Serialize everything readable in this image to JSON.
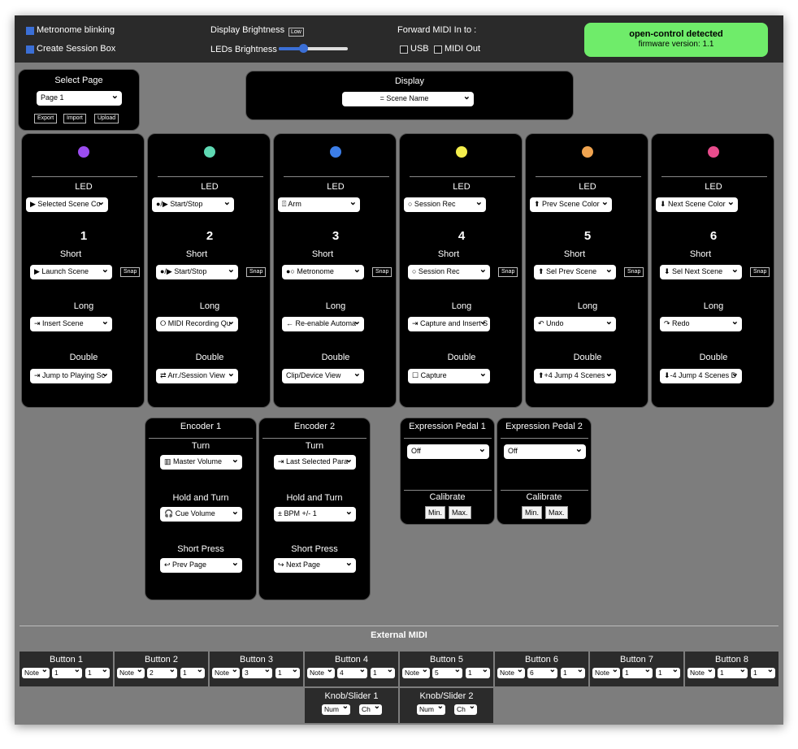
{
  "topbar": {
    "metronome_label": "Metronome blinking",
    "session_box_label": "Create Session Box",
    "display_brightness_label": "Display Brightness",
    "display_brightness_value": "Low",
    "leds_brightness_label": "LEDs Brightness",
    "leds_brightness_level": 0.35,
    "forward_label": "Forward MIDI In to :",
    "usb_label": "USB",
    "midi_out_label": "MIDI Out",
    "detect_title": "open-control detected",
    "firmware": "firmware version: 1.1"
  },
  "page_select": {
    "title": "Select Page",
    "value": "Page 1",
    "export": "Export",
    "import": "Import",
    "upload": "Upload"
  },
  "display": {
    "title": "Display",
    "value": "= Scene Name"
  },
  "led_label": "LED",
  "short_label": "Short",
  "long_label": "Long",
  "double_label": "Double",
  "snap_label": "Snap",
  "buttons": [
    {
      "color": "#9b4cf0",
      "num": "1",
      "led": "▶ Selected Scene Co",
      "short": "▶ Launch Scene",
      "long": "⇥ Insert Scene",
      "double": "⇥ Jump to Playing Sc"
    },
    {
      "color": "#5fd9b3",
      "num": "2",
      "led": "●/▶ Start/Stop",
      "short": "●/▶ Start/Stop",
      "long": "⭘ MIDI Recording Qu",
      "double": "⇄ Arr./Session View"
    },
    {
      "color": "#3c7ee8",
      "num": "3",
      "led": "⍐ Arm",
      "short": "●○ Metronome",
      "long": "← Re-enable Automa",
      "double": "Clip/Device View"
    },
    {
      "color": "#f4ee4c",
      "num": "4",
      "led": "○ Session Rec",
      "short": "○ Session Rec",
      "long": "⇥ Capture and Insert S",
      "double": "☐ Capture"
    },
    {
      "color": "#f0a450",
      "num": "5",
      "led": "⬆ Prev Scene Color",
      "short": "⬆ Sel Prev Scene",
      "long": "↶ Undo",
      "double": "⬆+4 Jump 4 Scenes"
    },
    {
      "color": "#e84c8c",
      "num": "6",
      "led": "⬇ Next Scene Color",
      "short": "⬇ Sel Next Scene",
      "long": "↷ Redo",
      "double": "⬇-4 Jump 4 Scenes D"
    }
  ],
  "turn_label": "Turn",
  "hold_turn_label": "Hold and Turn",
  "short_press_label": "Short Press",
  "encoders": [
    {
      "title": "Encoder 1",
      "turn": "▥ Master Volume",
      "hold": "🎧 Cue Volume",
      "press": "↩ Prev Page"
    },
    {
      "title": "Encoder 2",
      "turn": "⇥ Last Selected Para",
      "hold": "± BPM +/- 1",
      "press": "↪ Next Page"
    }
  ],
  "calibrate_label": "Calibrate",
  "min_label": "Min.",
  "max_label": "Max.",
  "pedals": [
    {
      "title": "Expression Pedal 1",
      "value": "Off"
    },
    {
      "title": "Expression Pedal 2",
      "value": "Off"
    }
  ],
  "external": {
    "title": "External MIDI",
    "buttons": [
      {
        "label": "Button 1",
        "type": "Note",
        "num": "1",
        "ch": "1"
      },
      {
        "label": "Button 2",
        "type": "Note",
        "num": "2",
        "ch": "1"
      },
      {
        "label": "Button 3",
        "type": "Note",
        "num": "3",
        "ch": "1"
      },
      {
        "label": "Button 4",
        "type": "Note",
        "num": "4",
        "ch": "1"
      },
      {
        "label": "Button 5",
        "type": "Note",
        "num": "5",
        "ch": "1"
      },
      {
        "label": "Button 6",
        "type": "Note",
        "num": "6",
        "ch": "1"
      },
      {
        "label": "Button 7",
        "type": "Note",
        "num": "1",
        "ch": "1"
      },
      {
        "label": "Button 8",
        "type": "Note",
        "num": "1",
        "ch": "1"
      }
    ],
    "knobs": [
      {
        "label": "Knob/Slider 1",
        "num": "Num",
        "ch": "Ch"
      },
      {
        "label": "Knob/Slider 2",
        "num": "Num",
        "ch": "Ch"
      }
    ]
  }
}
